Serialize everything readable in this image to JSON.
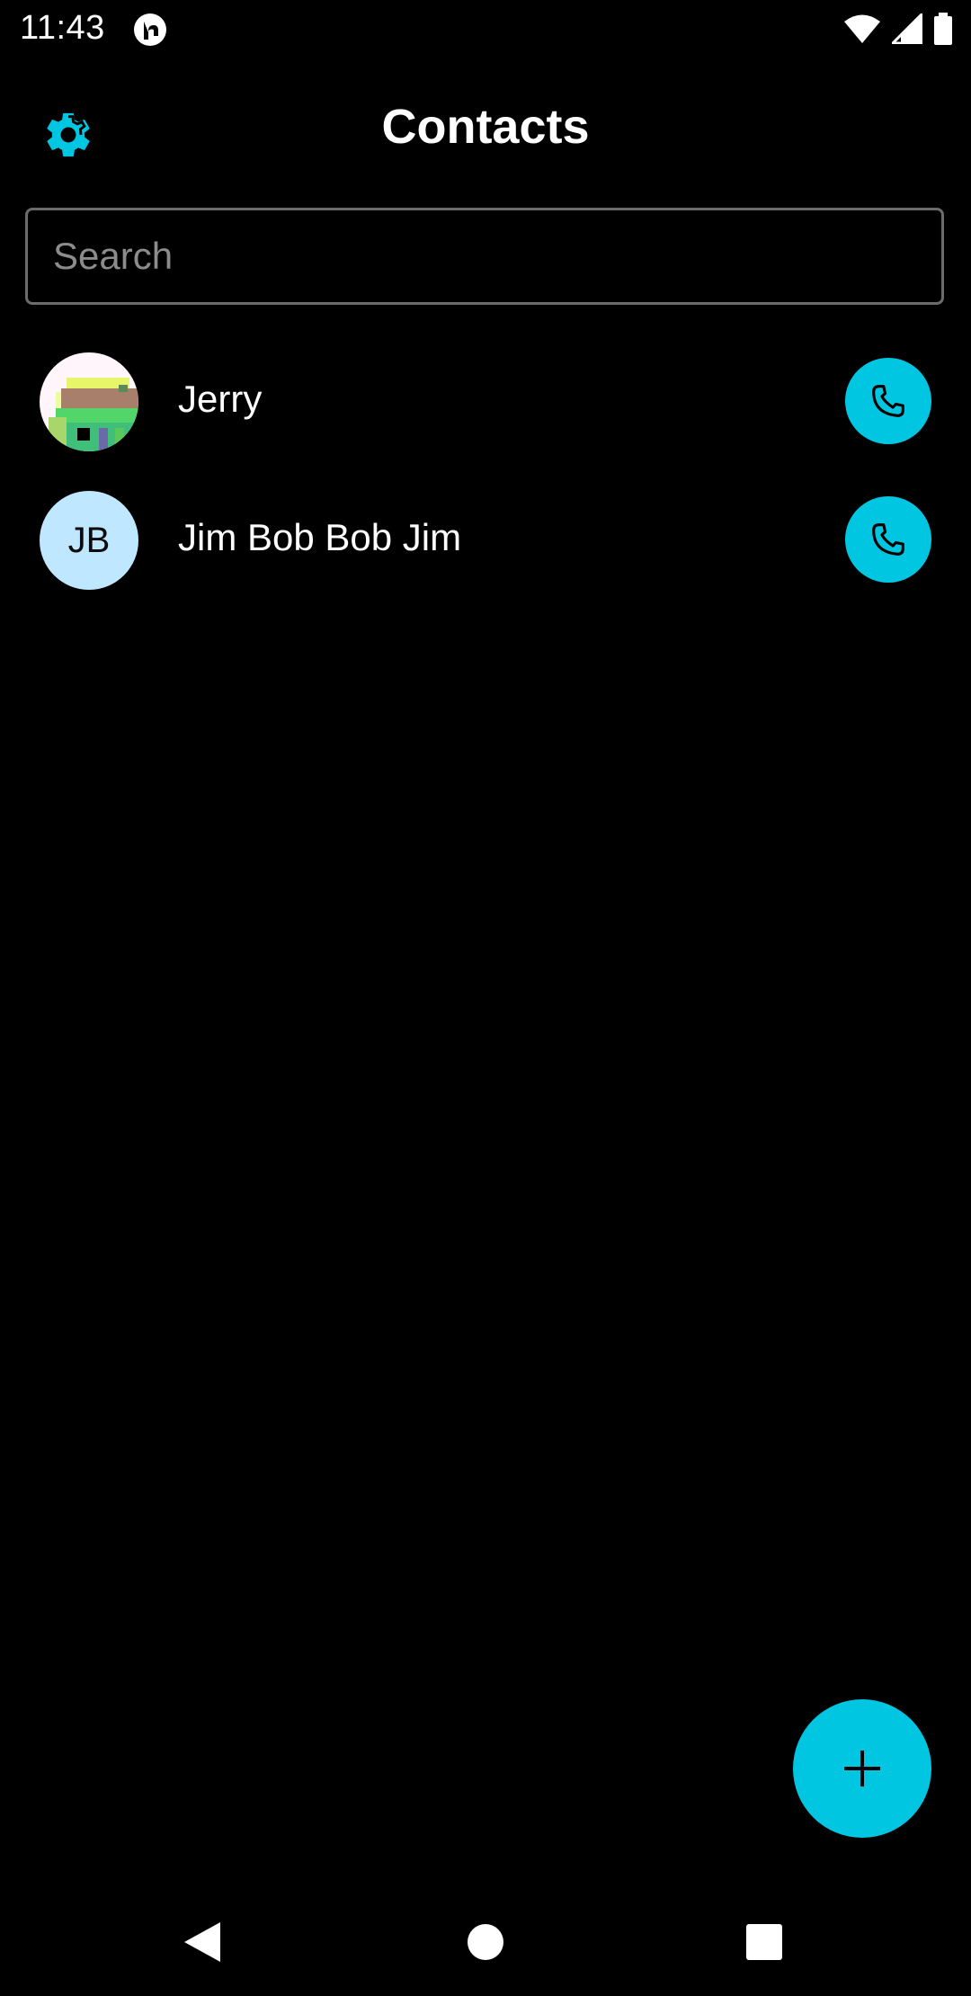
{
  "status_bar": {
    "time": "11:43",
    "icons": [
      "app-notification-icon",
      "wifi-icon",
      "cell-signal-icon",
      "battery-icon"
    ]
  },
  "header": {
    "title": "Contacts",
    "settings_icon": "gear-icon"
  },
  "search": {
    "placeholder": "Search",
    "value": ""
  },
  "contacts": [
    {
      "name": "Jerry",
      "avatar_type": "image",
      "action_icon": "phone-icon"
    },
    {
      "name": "Jim Bob Bob Jim",
      "initials": "JB",
      "avatar_type": "initials",
      "action_icon": "phone-icon"
    }
  ],
  "fab": {
    "icon": "plus-icon"
  },
  "nav_bar": {
    "buttons": [
      "back-icon",
      "home-icon",
      "recents-icon"
    ]
  },
  "colors": {
    "background": "#000000",
    "accent": "#00c6e2",
    "initials_avatar": "#bfe7ff",
    "search_border": "#6b6b6b"
  }
}
